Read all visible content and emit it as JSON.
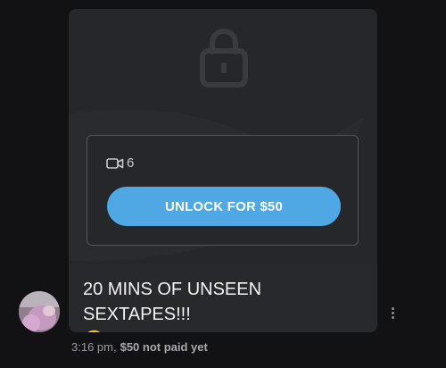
{
  "post": {
    "media_count": "6",
    "unlock_label": "UNLOCK FOR $50",
    "message": "20 MINS OF UNSEEN SEXTAPES!!!",
    "emoji": "🤤"
  },
  "meta": {
    "time": "3:16 pm,",
    "price_status": "$50 not paid yet"
  },
  "icons": {
    "lock": "lock-icon",
    "video": "video-camera-icon",
    "more": "more-vertical-icon"
  },
  "colors": {
    "accent": "#4fa7e4",
    "background": "#121214",
    "card": "#28292c"
  }
}
